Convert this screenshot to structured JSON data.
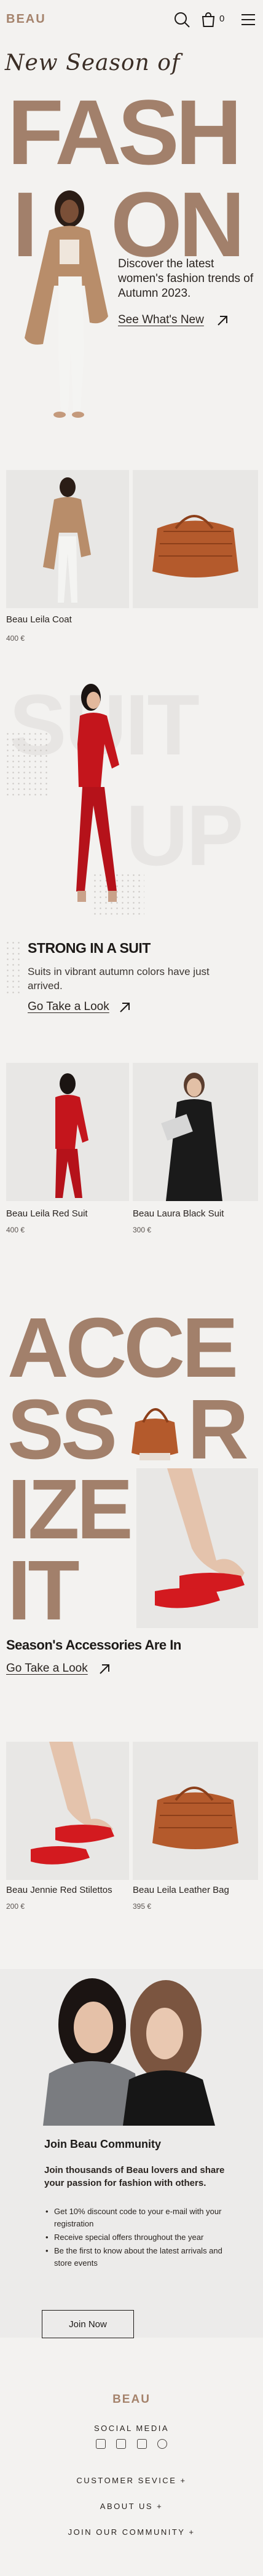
{
  "header": {
    "logo": "BEAU",
    "cart_count": "0"
  },
  "hero": {
    "script_heading": "New Season of",
    "big_word_top": "FASH",
    "big_word_left": "I",
    "big_word_right": "ON",
    "description": "Discover the latest women's fashion trends of Autumn 2023.",
    "cta": "See What's New"
  },
  "products_1": [
    {
      "name": "Beau Leila Coat",
      "price": "400 €"
    },
    {
      "name": "",
      "price": ""
    }
  ],
  "suit_section": {
    "ghost_top": "SUIT",
    "ghost_bottom": "UP",
    "title": "STRONG IN A SUIT",
    "subtitle": "Suits in vibrant autumn colors have just arrived.",
    "cta": "Go Take a Look"
  },
  "products_2": [
    {
      "name": "Beau Leila Red Suit",
      "price": "400 €"
    },
    {
      "name": "Beau Laura Black Suit",
      "price": "300 €"
    }
  ],
  "accessories": {
    "line1": "ACCE",
    "line2a": "SS",
    "line2b": "R",
    "line3": "IZE",
    "line4": "IT",
    "title": "Season's Accessories Are In",
    "cta": "Go Take a Look"
  },
  "products_3": [
    {
      "name": "Beau Jennie Red Stilettos",
      "price": "200 €"
    },
    {
      "name": "Beau Leila Leather Bag",
      "price": "395 €"
    }
  ],
  "community": {
    "title": "Join Beau Community",
    "text": "Join thousands of Beau lovers and share your passion for fashion with others.",
    "bullets": [
      "Get 10% discount code to your e-mail with your registration",
      "Receive special offers throughout the year",
      "Be the first to know about the latest arrivals and store events"
    ],
    "button": "Join Now"
  },
  "footer": {
    "logo": "BEAU",
    "social_heading": "SOCIAL MEDIA",
    "social_icons": [
      "linkedin-icon",
      "instagram-icon",
      "youtube-icon",
      "pinterest-icon"
    ],
    "links": [
      "CUSTOMER SEVICE +",
      "ABOUT US +",
      "JOIN OUR COMMUNITY +"
    ]
  },
  "colors": {
    "brand": "#a5836c",
    "background": "#f3f2f0",
    "text": "#1d1a18",
    "accent_red": "#c4151c"
  }
}
